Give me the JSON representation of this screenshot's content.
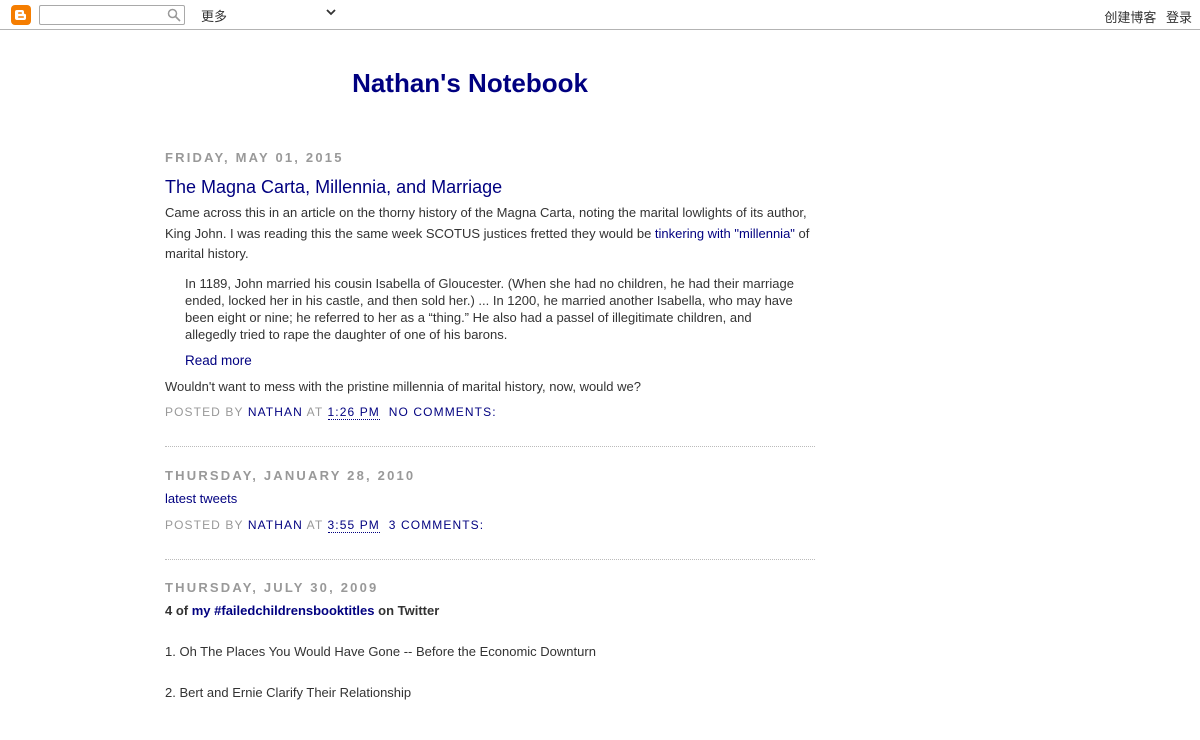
{
  "navbar": {
    "logo": "blogger-icon",
    "search_placeholder": "",
    "more_label": "更多",
    "create_blog": "创建博客",
    "sign_in": "登录"
  },
  "blog": {
    "title": "Nathan's Notebook"
  },
  "posts": [
    {
      "date": "Friday, May 01, 2015",
      "title": "The Magna Carta, Millennia, and Marriage",
      "intro_1": "Came across this in an article on the thorny history of the Magna Carta, noting the marital lowlights of its author, King John. I was reading this the same week SCOTUS justices fretted they would be ",
      "intro_link": "tinkering with \"millennia\"",
      "intro_2": " of marital history.",
      "quote": "In 1189, John married his cousin Isabella of Gloucester. (When she had no children, he had their marriage ended, locked her in his castle, and then sold her.) ... In 1200, he married another Isabella, who may have been eight or nine; he referred to her as a “thing.” He also had a passel of illegitimate children, and allegedly tried to rape the daughter of one of his barons.",
      "read_more": "Read more",
      "closing": "Wouldn't want to mess with the pristine millennia of marital history, now, would we?",
      "posted_by": "Posted by",
      "author": "Nathan",
      "at": "at",
      "time": "1:26 PM",
      "comments": "No comments:"
    },
    {
      "date": "Thursday, January 28, 2010",
      "body_link": "latest tweets",
      "posted_by": "Posted by",
      "author": "Nathan",
      "at": "at",
      "time": "3:55 PM",
      "comments": "3 comments:"
    },
    {
      "date": "Thursday, July 30, 2009",
      "lead_1": "4 of ",
      "lead_link": "my #failedchildrensbooktitles",
      "lead_2": " on Twitter",
      "items": [
        "1. Oh The Places You Would Have Gone -- Before the Economic Downturn",
        "2. Bert and Ernie Clarify Their Relationship"
      ]
    }
  ]
}
